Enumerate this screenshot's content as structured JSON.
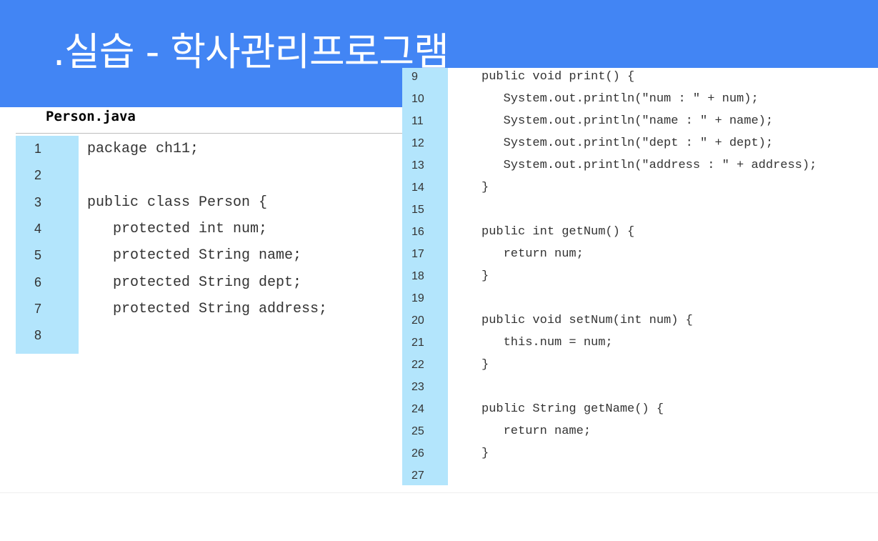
{
  "slide": {
    "title": ".실습 - 학사관리프로그램",
    "file_name": "Person.java"
  },
  "colors": {
    "header": "#4285f4",
    "gutter": "#b3e5fc",
    "code_text": "#333333"
  },
  "left_code": {
    "lines": [
      {
        "n": "1",
        "code": "package ch11;"
      },
      {
        "n": "2",
        "code": ""
      },
      {
        "n": "3",
        "code": "public class Person {"
      },
      {
        "n": "4",
        "code": "   protected int num;"
      },
      {
        "n": "5",
        "code": "   protected String name;"
      },
      {
        "n": "6",
        "code": "   protected String dept;"
      },
      {
        "n": "7",
        "code": "   protected String address;"
      },
      {
        "n": "8",
        "code": ""
      }
    ]
  },
  "right_code": {
    "lines": [
      {
        "n": "9",
        "code": "public void print() {"
      },
      {
        "n": "10",
        "code": "   System.out.println(\"num : \" + num);"
      },
      {
        "n": "11",
        "code": "   System.out.println(\"name : \" + name);"
      },
      {
        "n": "12",
        "code": "   System.out.println(\"dept : \" + dept);"
      },
      {
        "n": "13",
        "code": "   System.out.println(\"address : \" + address);"
      },
      {
        "n": "14",
        "code": "}"
      },
      {
        "n": "15",
        "code": ""
      },
      {
        "n": "16",
        "code": "public int getNum() {"
      },
      {
        "n": "17",
        "code": "   return num;"
      },
      {
        "n": "18",
        "code": "}"
      },
      {
        "n": "19",
        "code": ""
      },
      {
        "n": "20",
        "code": "public void setNum(int num) {"
      },
      {
        "n": "21",
        "code": "   this.num = num;"
      },
      {
        "n": "22",
        "code": "}"
      },
      {
        "n": "23",
        "code": ""
      },
      {
        "n": "24",
        "code": "public String getName() {"
      },
      {
        "n": "25",
        "code": "   return name;"
      },
      {
        "n": "26",
        "code": "}"
      },
      {
        "n": "27",
        "code": ""
      }
    ]
  }
}
